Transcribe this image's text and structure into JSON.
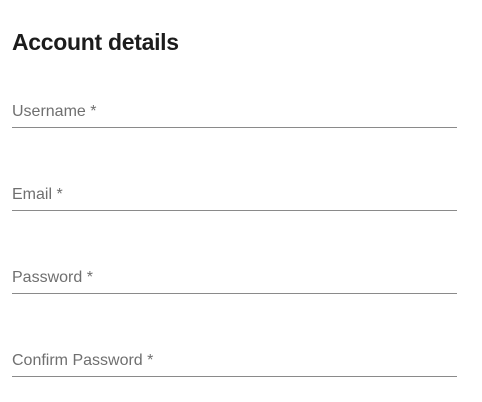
{
  "form": {
    "title": "Account details",
    "fields": [
      {
        "label": "Username *",
        "value": "",
        "type": "text"
      },
      {
        "label": "Email *",
        "value": "",
        "type": "email"
      },
      {
        "label": "Password *",
        "value": "",
        "type": "password"
      },
      {
        "label": "Confirm Password *",
        "value": "",
        "type": "password"
      }
    ]
  },
  "colors": {
    "title": "#1c1c1c",
    "label": "#6f6f6f",
    "underline": "#8a8a8a",
    "background": "#ffffff"
  }
}
